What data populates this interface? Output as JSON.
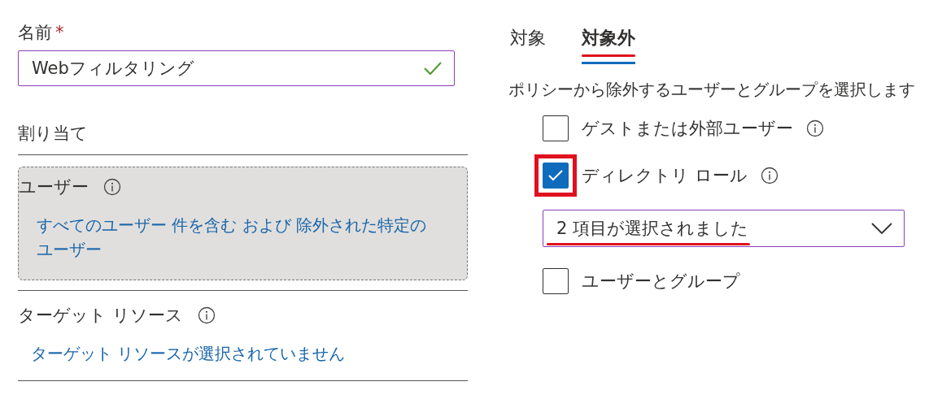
{
  "name_field": {
    "label": "名前",
    "required_mark": "*",
    "value": "Webフィルタリング",
    "valid": true
  },
  "assignments": {
    "heading": "割り当て",
    "users": {
      "label": "ユーザー",
      "info": true,
      "link": "すべてのユーザー 件を含む および 除外された特定のユーザー"
    },
    "target": {
      "label": "ターゲット リソース",
      "info": true,
      "link": "ターゲット リソースが選択されていません"
    }
  },
  "tabs": [
    {
      "label": "対象",
      "selected": false,
      "highlighted": false
    },
    {
      "label": "対象外",
      "selected": true,
      "highlighted": true
    }
  ],
  "description": "ポリシーから除外するユーザーとグループを選択します",
  "options": [
    {
      "kind": "checkbox",
      "label": "ゲストまたは外部ユーザー",
      "checked": false,
      "info": true,
      "highlighted": false
    },
    {
      "kind": "checkbox",
      "label": "ディレクトリ ロール",
      "checked": true,
      "info": true,
      "highlighted": true
    },
    {
      "kind": "dropdown",
      "value": "2 項目が選択されました",
      "highlighted": true
    },
    {
      "kind": "checkbox",
      "label": "ユーザーとグループ",
      "checked": false,
      "info": false,
      "highlighted": false
    }
  ]
}
